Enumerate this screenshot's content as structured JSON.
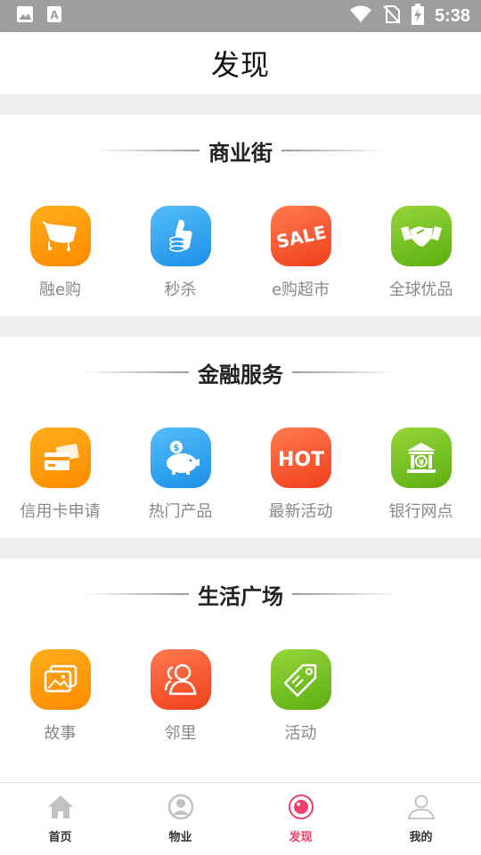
{
  "status_bar": {
    "time": "5:38",
    "icons": [
      "image-icon",
      "text-a-icon",
      "wifi-icon",
      "no-sim-icon",
      "battery-charging-icon"
    ]
  },
  "header": {
    "title": "发现"
  },
  "sections": [
    {
      "title": "商业街",
      "items": [
        {
          "label": "融e购",
          "icon": "shopping-cart-icon",
          "color": "#ff9a0e"
        },
        {
          "label": "秒杀",
          "icon": "thumbs-up-coins-icon",
          "color": "#2e9ff0"
        },
        {
          "label": "e购超市",
          "icon": "sale-tag-icon",
          "color": "#f5512a"
        },
        {
          "label": "全球优品",
          "icon": "handshake-icon",
          "color": "#74c221"
        }
      ]
    },
    {
      "title": "金融服务",
      "items": [
        {
          "label": "信用卡申请",
          "icon": "credit-card-icon",
          "color": "#ff9a0e"
        },
        {
          "label": "热门产品",
          "icon": "piggy-bank-icon",
          "color": "#2e9ff0"
        },
        {
          "label": "最新活动",
          "icon": "hot-icon",
          "color": "#f5512a"
        },
        {
          "label": "银行网点",
          "icon": "bank-building-icon",
          "color": "#74c221"
        }
      ]
    },
    {
      "title": "生活广场",
      "items": [
        {
          "label": "故事",
          "icon": "photo-stack-icon",
          "color": "#ff9a0e"
        },
        {
          "label": "邻里",
          "icon": "people-icon",
          "color": "#f5512a"
        },
        {
          "label": "活动",
          "icon": "price-tag-icon",
          "color": "#74c221"
        }
      ]
    }
  ],
  "tab_bar": {
    "active": "发现",
    "accent_color": "#f0406a",
    "tabs": [
      {
        "label": "首页",
        "icon": "home-icon"
      },
      {
        "label": "物业",
        "icon": "property-person-icon"
      },
      {
        "label": "发现",
        "icon": "discover-icon"
      },
      {
        "label": "我的",
        "icon": "user-profile-icon"
      }
    ]
  }
}
